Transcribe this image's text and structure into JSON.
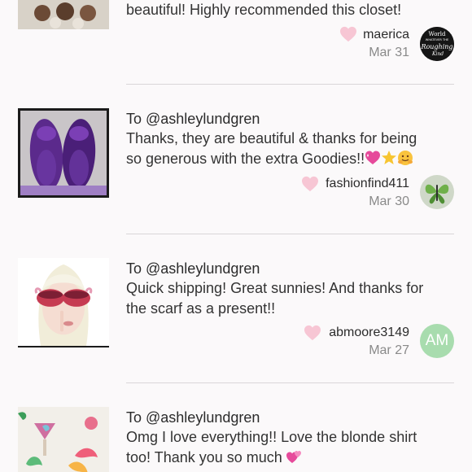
{
  "reviews": [
    {
      "to": "",
      "comment_lines": [
        "beautiful! Highly recommended this closet!"
      ],
      "username": "maerica",
      "date": "Mar 31",
      "avatar_text": "World Whatever The Roughing Kind",
      "thumb_icon": "dessert-photo"
    },
    {
      "to": "To @ashleylundgren",
      "comment_lines": [
        "Thanks, they are beautiful & thanks for being",
        "so generous with the extra Goodies!!"
      ],
      "username": "fashionfind411",
      "date": "Mar 30",
      "thumb_icon": "purple-flats-photo",
      "avatar_icon": "green-butterfly-avatar"
    },
    {
      "to": "To @ashleylundgren",
      "comment_lines": [
        "Quick shipping! Great sunnies! And thanks for",
        "the scarf as a present!!"
      ],
      "username": "abmoore3149",
      "date": "Mar 27",
      "avatar_initials": "AM",
      "thumb_icon": "sunglasses-photo"
    },
    {
      "to": "To @ashleylundgren",
      "comment_lines": [
        "Omg I love everything!! Love the blonde shirt",
        "too! Thank you so much"
      ],
      "username": "",
      "date": "",
      "thumb_icon": "tropical-print-photo"
    }
  ],
  "colors": {
    "heart": "#f7c6d4",
    "avatar_initials_bg": "#a8dcae",
    "divider": "#d9d6d8",
    "background": "#fbf9fa"
  }
}
